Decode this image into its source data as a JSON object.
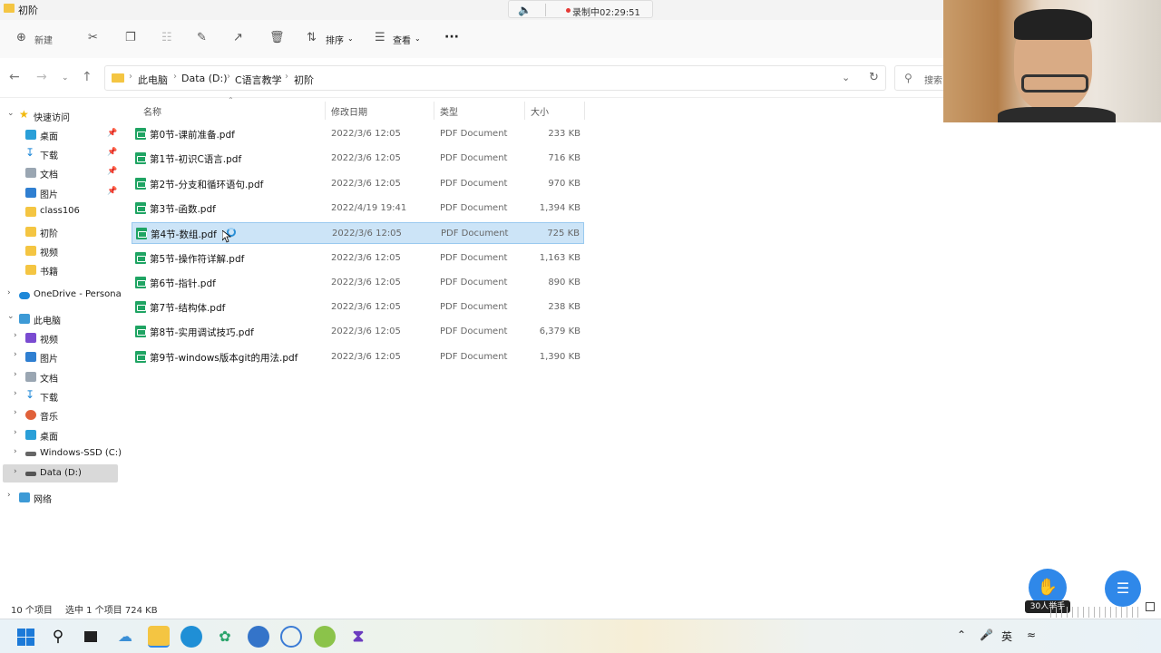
{
  "window": {
    "title": "初阶"
  },
  "recording": {
    "label": "录制中02:29:51",
    "speaker_icon": "speaker-muted-icon"
  },
  "toolbar": {
    "new_label": "新建",
    "sort_label": "排序",
    "view_label": "查看",
    "more_label": "···"
  },
  "address": {
    "crumbs": [
      "此电脑",
      "Data (D:)",
      "C语言教学",
      "初阶"
    ],
    "search_placeholder": "搜索"
  },
  "sidebar": {
    "quick_access": "快速访问",
    "quick_items": [
      "桌面",
      "下载",
      "文档",
      "图片",
      "class106",
      "初阶",
      "视频",
      "书籍"
    ],
    "onedrive": "OneDrive - Persona",
    "this_pc": "此电脑",
    "pc_items": [
      "视频",
      "图片",
      "文档",
      "下载",
      "音乐",
      "桌面",
      "Windows-SSD (C:)",
      "Data (D:)"
    ],
    "network": "网络"
  },
  "columns": {
    "name": "名称",
    "date": "修改日期",
    "type": "类型",
    "size": "大小"
  },
  "files": [
    {
      "name": "第0节-课前准备.pdf",
      "date": "2022/3/6 12:05",
      "type": "PDF Document",
      "size": "233 KB"
    },
    {
      "name": "第1节-初识C语言.pdf",
      "date": "2022/3/6 12:05",
      "type": "PDF Document",
      "size": "716 KB"
    },
    {
      "name": "第2节-分支和循环语句.pdf",
      "date": "2022/3/6 12:05",
      "type": "PDF Document",
      "size": "970 KB"
    },
    {
      "name": "第3节-函数.pdf",
      "date": "2022/4/19 19:41",
      "type": "PDF Document",
      "size": "1,394 KB"
    },
    {
      "name": "第4节-数组.pdf",
      "date": "2022/3/6 12:05",
      "type": "PDF Document",
      "size": "725 KB"
    },
    {
      "name": "第5节-操作符详解.pdf",
      "date": "2022/3/6 12:05",
      "type": "PDF Document",
      "size": "1,163 KB"
    },
    {
      "name": "第6节-指针.pdf",
      "date": "2022/3/6 12:05",
      "type": "PDF Document",
      "size": "890 KB"
    },
    {
      "name": "第7节-结构体.pdf",
      "date": "2022/3/6 12:05",
      "type": "PDF Document",
      "size": "238 KB"
    },
    {
      "name": "第8节-实用调试技巧.pdf",
      "date": "2022/3/6 12:05",
      "type": "PDF Document",
      "size": "6,379 KB"
    },
    {
      "name": "第9节-windows版本git的用法.pdf",
      "date": "2022/3/6 12:05",
      "type": "PDF Document",
      "size": "1,390 KB"
    }
  ],
  "selected_file_index": 4,
  "status": {
    "count": "10 个项目",
    "selection": "选中 1 个项目  724 KB"
  },
  "live": {
    "raise_hand_label": "30人举手"
  },
  "tray": {
    "ime": "英"
  },
  "colors": {
    "accent": "#2f88e9",
    "selection": "#cce4f7",
    "pdf_icon": "#1fa463",
    "folder": "#f4c542"
  }
}
